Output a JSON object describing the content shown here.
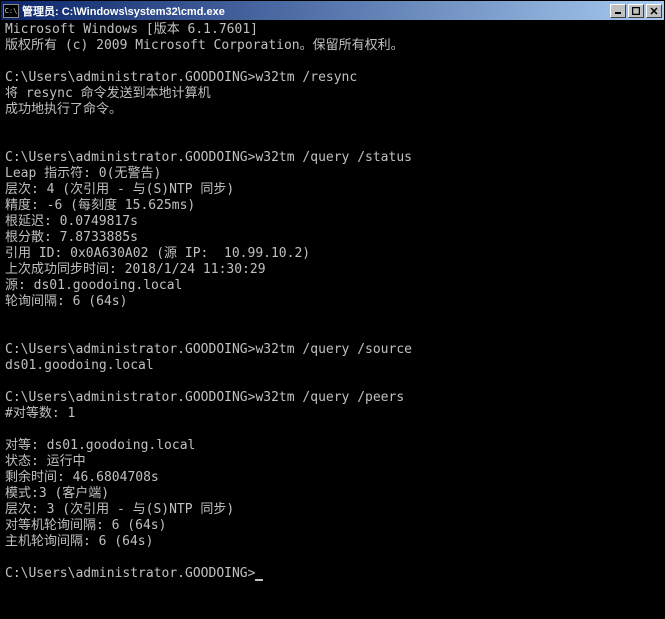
{
  "window": {
    "icon_label": "C:\\",
    "title": "管理员: C:\\Windows\\system32\\cmd.exe"
  },
  "terminal": {
    "lines": [
      "Microsoft Windows [版本 6.1.7601]",
      "版权所有 (c) 2009 Microsoft Corporation。保留所有权利。",
      "",
      "C:\\Users\\administrator.GOODOING>w32tm /resync",
      "将 resync 命令发送到本地计算机",
      "成功地执行了命令。",
      "",
      "",
      "C:\\Users\\administrator.GOODOING>w32tm /query /status",
      "Leap 指示符: 0(无警告)",
      "层次: 4 (次引用 - 与(S)NTP 同步)",
      "精度: -6 (每刻度 15.625ms)",
      "根延迟: 0.0749817s",
      "根分散: 7.8733885s",
      "引用 ID: 0x0A630A02 (源 IP:  10.99.10.2)",
      "上次成功同步时间: 2018/1/24 11:30:29",
      "源: ds01.goodoing.local",
      "轮询间隔: 6 (64s)",
      "",
      "",
      "C:\\Users\\administrator.GOODOING>w32tm /query /source",
      "ds01.goodoing.local",
      "",
      "C:\\Users\\administrator.GOODOING>w32tm /query /peers",
      "#对等数: 1",
      "",
      "对等: ds01.goodoing.local",
      "状态: 运行中",
      "剩余时间: 46.6804708s",
      "模式:3 (客户端)",
      "层次: 3 (次引用 - 与(S)NTP 同步)",
      "对等机轮询间隔: 6 (64s)",
      "主机轮询间隔: 6 (64s)",
      "",
      "C:\\Users\\administrator.GOODOING>"
    ],
    "prompt_path": "C:\\Users\\administrator.GOODOING"
  }
}
